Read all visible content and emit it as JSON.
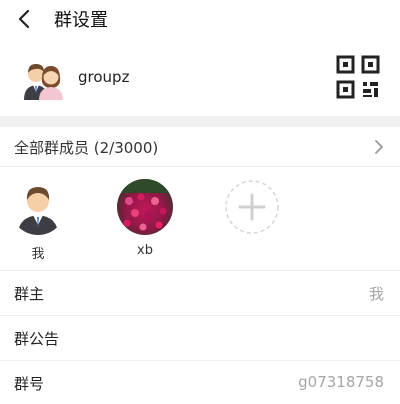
{
  "header": {
    "title": "群设置"
  },
  "group": {
    "name": "groupz"
  },
  "members": {
    "label": "全部群成员 (2/3000)",
    "list": [
      {
        "name": "我"
      },
      {
        "name": "xb"
      }
    ]
  },
  "settings": {
    "owner": {
      "label": "群主",
      "value": "我"
    },
    "announcement": {
      "label": "群公告"
    },
    "group_id": {
      "label": "群号",
      "value": "g07318758"
    }
  },
  "colors": {
    "divider": "#eeeeee",
    "gap": "#f0f0f0",
    "muted_text": "#a6a6a6"
  }
}
